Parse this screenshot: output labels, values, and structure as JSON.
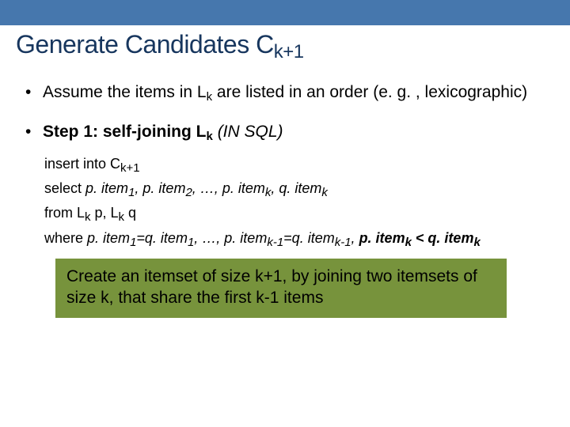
{
  "title": {
    "main": "Generate Candidates C",
    "sub": "k+1"
  },
  "bullet1": {
    "pre": "Assume the items in L",
    "sub": "k",
    "post": " are listed in an order (e. g. , lexicographic)"
  },
  "bullet2": {
    "label_pre": "Step 1: self-joining L",
    "label_sub": "k",
    "paren": " (IN SQL)"
  },
  "sql": {
    "line1": {
      "pre": "insert into C",
      "sub": "k+1"
    },
    "line2": {
      "pre": "select ",
      "p1": "p. item",
      "s1": "1",
      "c1": ", ",
      "p2": "p. item",
      "s2": "2",
      "c2": ", …, ",
      "p3": "p. item",
      "s3": "k",
      "c3": ", ",
      "p4": "q. item",
      "s4": "k"
    },
    "line3": {
      "pre": "from L",
      "sub1": "k",
      "mid": " p, L",
      "sub2": "k",
      "post": " q"
    },
    "line4": {
      "pre": "where ",
      "a1": "p. item",
      "as1": "1",
      "eq1": "=q. item",
      "bs1": "1",
      "c1": ", …, ",
      "a2": "p. item",
      "as2": "k-1",
      "eq2": "=q. item",
      "bs2": "k-1",
      "c2": ", ",
      "bold_pre": "p. item",
      "bold_sub1": "k",
      "bold_mid": " < q. item",
      "bold_sub2": "k"
    }
  },
  "callout": "Create an itemset of size k+1, by joining two itemsets of size k, that share the first k-1 items"
}
